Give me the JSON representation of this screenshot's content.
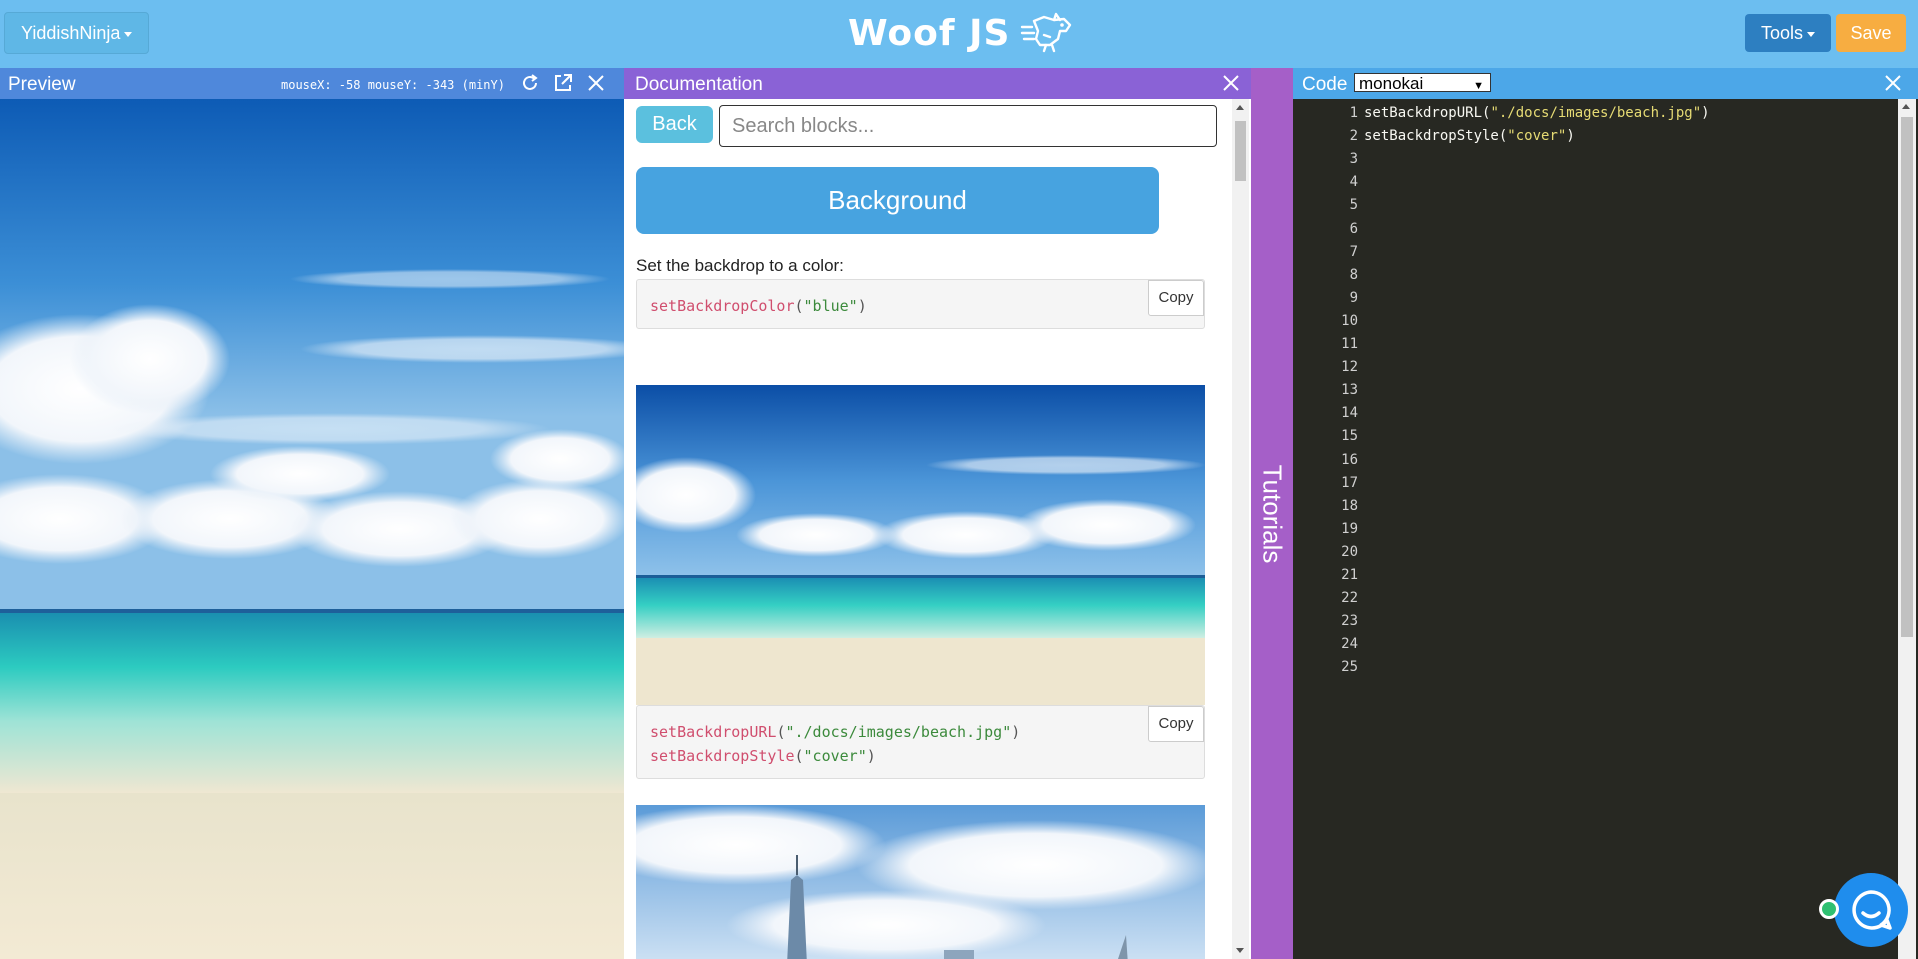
{
  "topbar": {
    "user_menu_label": "YiddishNinja",
    "logo_text": "Woof JS",
    "tools_label": "Tools",
    "save_label": "Save"
  },
  "preview": {
    "title": "Preview",
    "mouse_readout": "mouseX: -58 mouseY: -343 (minY)"
  },
  "docs": {
    "title": "Documentation",
    "back_label": "Back",
    "search_placeholder": "Search blocks...",
    "section_label": "Background",
    "color_description": "Set the backdrop to a color:",
    "copy_label": "Copy",
    "example1": {
      "fn": "setBackdropColor",
      "arg": "\"blue\""
    },
    "example2": {
      "line1_fn": "setBackdropURL",
      "line1_arg": "\"./docs/images/beach.jpg\"",
      "line2_fn": "setBackdropStyle",
      "line2_arg": "\"cover\""
    }
  },
  "tutorials": {
    "label": "Tutorials"
  },
  "code": {
    "title": "Code",
    "theme": "monokai",
    "lines": [
      {
        "n": "1",
        "fn": "setBackdropURL(",
        "str": "\"./docs/images/beach.jpg\"",
        "end": ")"
      },
      {
        "n": "2",
        "fn": "setBackdropStyle(",
        "str": "\"cover\"",
        "end": ")"
      },
      {
        "n": "3"
      },
      {
        "n": "4"
      },
      {
        "n": "5"
      },
      {
        "n": "6"
      },
      {
        "n": "7"
      },
      {
        "n": "8"
      },
      {
        "n": "9"
      },
      {
        "n": "10"
      },
      {
        "n": "11"
      },
      {
        "n": "12"
      },
      {
        "n": "13"
      },
      {
        "n": "14"
      },
      {
        "n": "15"
      },
      {
        "n": "16"
      },
      {
        "n": "17"
      },
      {
        "n": "18"
      },
      {
        "n": "19"
      },
      {
        "n": "20"
      },
      {
        "n": "21"
      },
      {
        "n": "22"
      },
      {
        "n": "23"
      },
      {
        "n": "24"
      },
      {
        "n": "25"
      }
    ]
  },
  "icons": {
    "user_menu": "chevron-down-icon",
    "refresh": "refresh-icon",
    "open_external": "external-link-icon",
    "close": "close-icon",
    "chat": "chat-icon"
  }
}
